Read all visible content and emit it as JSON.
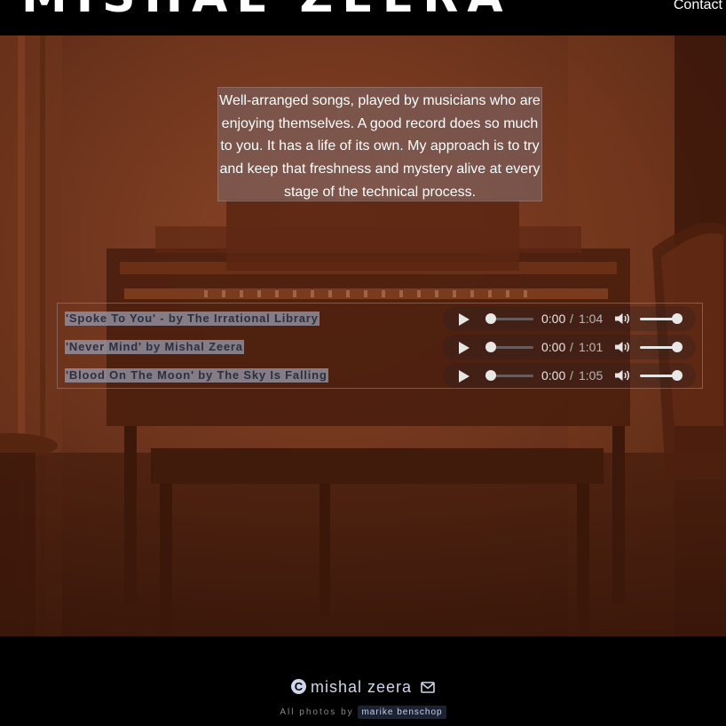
{
  "header": {
    "site_title": "MISHAL ZEERA",
    "nav_contact": "Contact"
  },
  "hero": {
    "quote": "Well-arranged songs, played by musicians who are enjoying themselves. A good record does so much to you. It has a life of its own. My approach is to try and keep that freshness and mystery alive at every stage of the technical process."
  },
  "tracks": [
    {
      "label": "'Spoke To You' - by The Irrational Library",
      "current": "0:00",
      "separator": "/",
      "duration": "1:04",
      "progress": 0,
      "volume": 1.0
    },
    {
      "label": "'Never Mind' by Mishal Zeera",
      "current": "0:00",
      "separator": "/",
      "duration": "1:01",
      "progress": 0,
      "volume": 1.0
    },
    {
      "label": "'Blood On The Moon' by The Sky Is Falling",
      "current": "0:00",
      "separator": "/",
      "duration": "1:05",
      "progress": 0,
      "volume": 1.0
    }
  ],
  "footer": {
    "copyright_icon": "C",
    "copyright_name": "mishal zeera",
    "photo_credit_prefix": "All photos by",
    "photo_credit_name": "marike benschop"
  },
  "icons": {
    "play": "play-icon",
    "volume": "volume-icon",
    "copyright": "copyright-icon",
    "envelope": "envelope-icon"
  },
  "colors": {
    "hero_tint": "#5a2a17",
    "quote_bg": "#7d6464",
    "footer_text": "#cdd6ea"
  }
}
